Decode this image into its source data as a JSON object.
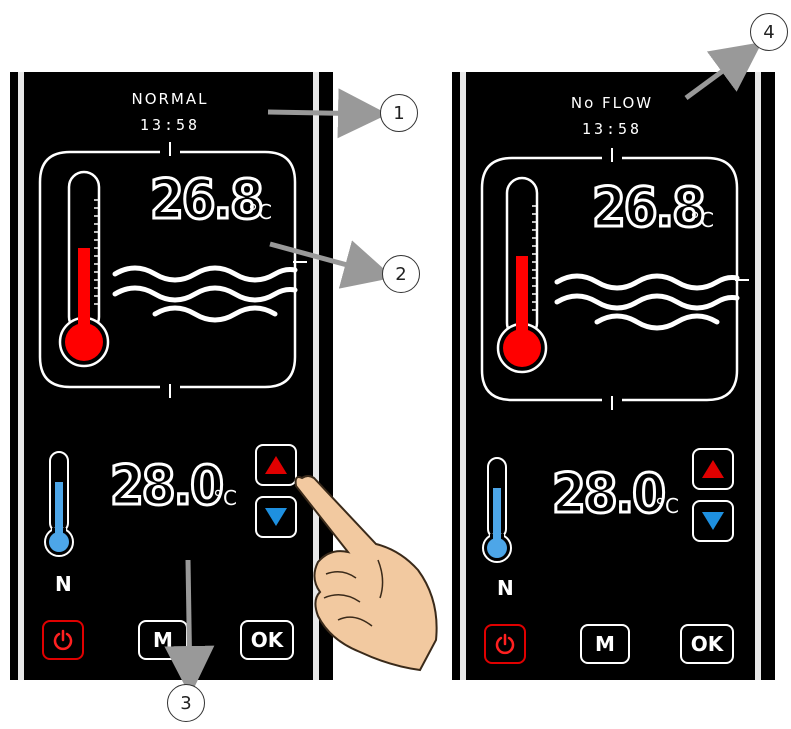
{
  "left_panel": {
    "status": "NORMAL",
    "time": "13:58",
    "water_temp": "26.8",
    "water_unit": "°C",
    "set_temp": "28.0",
    "set_unit": "°C",
    "mode_letter": "N",
    "buttons": {
      "power": "power-icon",
      "menu": "M",
      "ok": "OK"
    }
  },
  "right_panel": {
    "status": "No FLOW",
    "time": "13:58",
    "water_temp": "26.8",
    "water_unit": "°C",
    "set_temp": "28.0",
    "set_unit": "°C",
    "mode_letter": "N",
    "buttons": {
      "power": "power-icon",
      "menu": "M",
      "ok": "OK"
    }
  },
  "callouts": [
    "1",
    "2",
    "3",
    "4"
  ],
  "colors": {
    "thermometer_hot": "#ff0000",
    "thermometer_cold": "#4da6e8",
    "arrow_up": "#e00000",
    "arrow_down": "#1e90e0",
    "callout_arrow": "#999999"
  }
}
